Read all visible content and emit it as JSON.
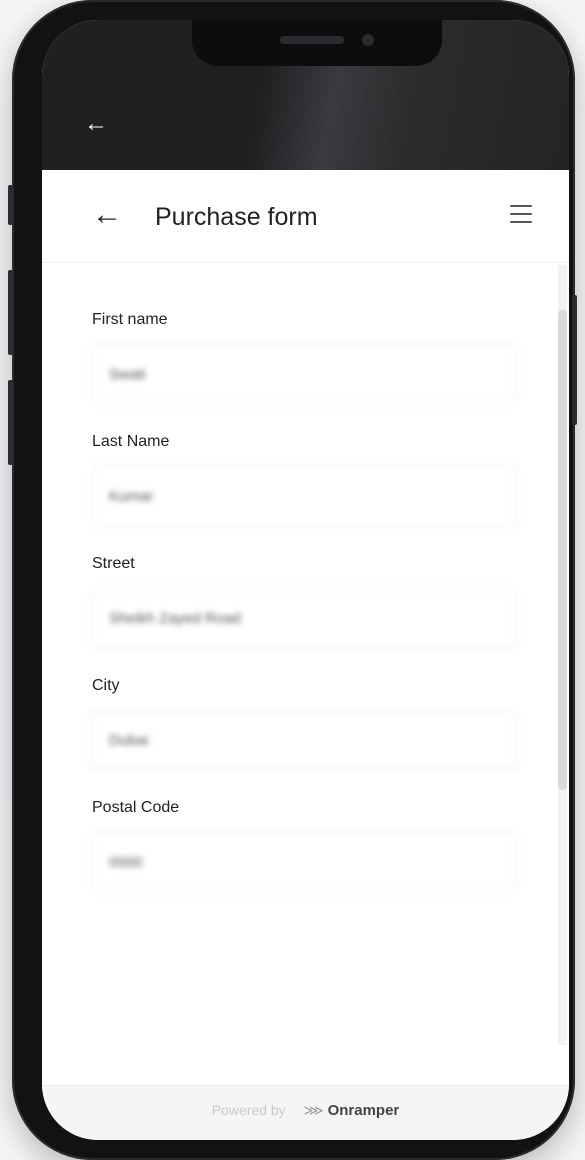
{
  "status_bar": {
    "back_icon": "arrow-left-icon",
    "back_glyph": "←"
  },
  "header": {
    "back_glyph": "←",
    "title": "Purchase form",
    "menu_icon": "hamburger-icon"
  },
  "form": {
    "fields": [
      {
        "label": "First name",
        "value": "Swati"
      },
      {
        "label": "Last Name",
        "value": "Kumar"
      },
      {
        "label": "Street",
        "value": "Sheikh Zayed Road"
      },
      {
        "label": "City",
        "value": "Dubai"
      },
      {
        "label": "Postal Code",
        "value": "0000"
      }
    ]
  },
  "footer": {
    "powered_by": "Powered by",
    "brand_glyph": "⋙",
    "brand_name": "Onramper"
  },
  "colors": {
    "status_bar": "#1f2022",
    "background": "#ffffff",
    "text": "#222222",
    "input_border": "#e4e6ea"
  }
}
